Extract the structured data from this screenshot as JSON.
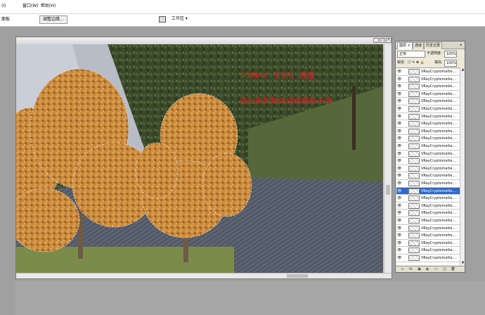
{
  "menu": {
    "items": [
      "(I)",
      "窗口(W)",
      "帮助(H)"
    ]
  },
  "options_bar": {
    "left_label": "面板",
    "button_label": "调整边缘...",
    "workspace_label": "工作区 ▾"
  },
  "document": {
    "controls": [
      "_",
      "□",
      "×"
    ]
  },
  "annotation": {
    "line1": "SOMAX（EXR）通道",
    "line2": "选出来的物体边缘截断干净",
    "color": "#e02020"
  },
  "layers_panel": {
    "tabs": [
      {
        "label": "图层 ×",
        "active": true
      },
      {
        "label": "通道",
        "active": false
      },
      {
        "label": "历史记录",
        "active": false
      }
    ],
    "menu_glyph": "▸",
    "blend_mode": "正常",
    "opacity_label": "不透明度:",
    "opacity_value": "100%",
    "lock_label": "锁定:",
    "fill_label": "填充:",
    "fill_value": "100%",
    "layer_name": "VRayCryptomatte....",
    "layer_count": 26,
    "selected_index": 16,
    "scroll_up": "▲",
    "scroll_down": "▼",
    "footer_icons": [
      "link-icon",
      "fx-icon",
      "mask-icon",
      "adjustment-icon",
      "group-icon",
      "new-layer-icon",
      "trash-icon"
    ],
    "footer_glyphs": [
      "∞",
      "fx",
      "▣",
      "◐",
      "▭",
      "◫",
      "🗑"
    ]
  },
  "colors": {
    "workspace": "#a0a0a0",
    "selection_blue": "#3169c6"
  }
}
